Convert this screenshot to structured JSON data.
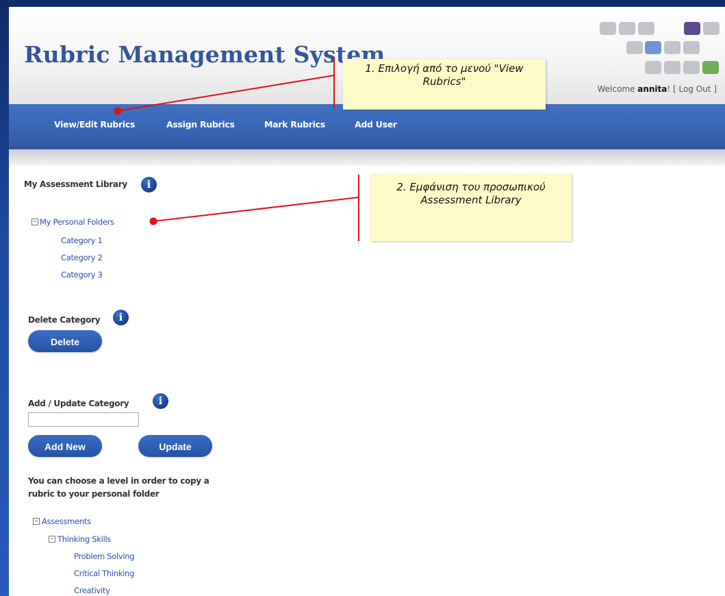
{
  "app": {
    "title": "Rubric Management System",
    "welcome_prefix": "Welcome ",
    "username": "annita",
    "welcome_suffix": "! [ ",
    "logout_label": "Log Out",
    "welcome_end": " ]"
  },
  "nav": {
    "items": [
      "View/Edit Rubrics",
      "Assign Rubrics",
      "Mark Rubrics",
      "Add User"
    ]
  },
  "library": {
    "heading": "My Assessment Library",
    "root": "My Personal Folders",
    "categories": [
      "Category 1",
      "Category 2",
      "Category 3"
    ]
  },
  "delete_section": {
    "heading": "Delete Category",
    "button": "Delete"
  },
  "update_section": {
    "heading": "Add / Update Category",
    "input_value": "",
    "add_button": "Add New",
    "update_button": "Update"
  },
  "help_text": "You can choose a level in order to copy a rubric to your personal folder",
  "assessments_tree": {
    "root": "Assessments",
    "child": "Thinking Skills",
    "leaves": [
      "Problem Solving",
      "Critical Thinking",
      "Creativity"
    ]
  },
  "callouts": {
    "one": "1. Επιλογή από το μενού \"View Rubrics\"",
    "two": "2. Εμφάνιση του προσωπικού Assessment Library"
  },
  "icons": {
    "info": "info-icon",
    "tree_toggle": "minus-box-icon"
  },
  "colors": {
    "brand_title": "#34569b",
    "nav_bar": "#3965b5",
    "link": "#2d4fb0",
    "button": "#2a58ab",
    "callout_bg": "#fdfbc8",
    "annotation_line": "#e0101a",
    "logo_tiles": [
      "#bfc0c6",
      "#5b4a8e",
      "#6f95d4",
      "#6dae5a"
    ]
  }
}
